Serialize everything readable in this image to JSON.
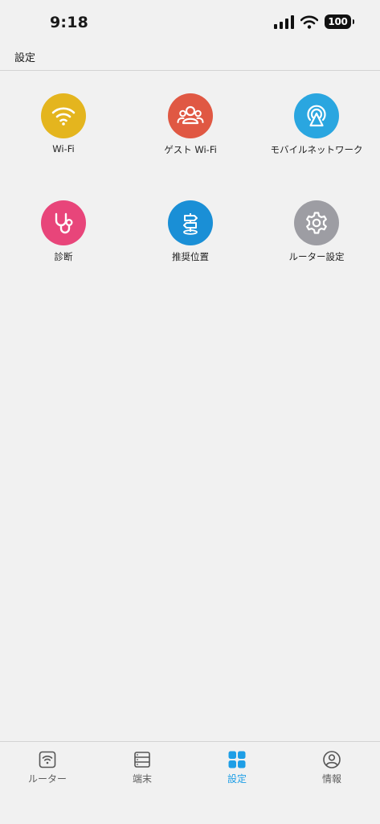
{
  "status_bar": {
    "time": "9:18",
    "battery": "100"
  },
  "header": {
    "title": "設定"
  },
  "settings": [
    {
      "label": "Wi-Fi",
      "icon": "wifi-icon",
      "color": "#e4b51e"
    },
    {
      "label": "ゲスト Wi-Fi",
      "icon": "guests-icon",
      "color": "#e05843"
    },
    {
      "label": "モバイルネットワーク",
      "icon": "antenna-icon",
      "color": "#2aa6e0"
    },
    {
      "label": "診断",
      "icon": "stethoscope-icon",
      "color": "#e8457a"
    },
    {
      "label": "推奨位置",
      "icon": "signpost-icon",
      "color": "#1a8fd6"
    },
    {
      "label": "ルーター設定",
      "icon": "gear-icon",
      "color": "#9d9da3"
    }
  ],
  "tab_bar": {
    "active_color": "#1e9ee6",
    "tabs": [
      {
        "label": "ルーター",
        "icon": "router-icon"
      },
      {
        "label": "端末",
        "icon": "device-list-icon"
      },
      {
        "label": "設定",
        "icon": "grid-icon",
        "active": true
      },
      {
        "label": "情報",
        "icon": "profile-icon"
      }
    ]
  }
}
